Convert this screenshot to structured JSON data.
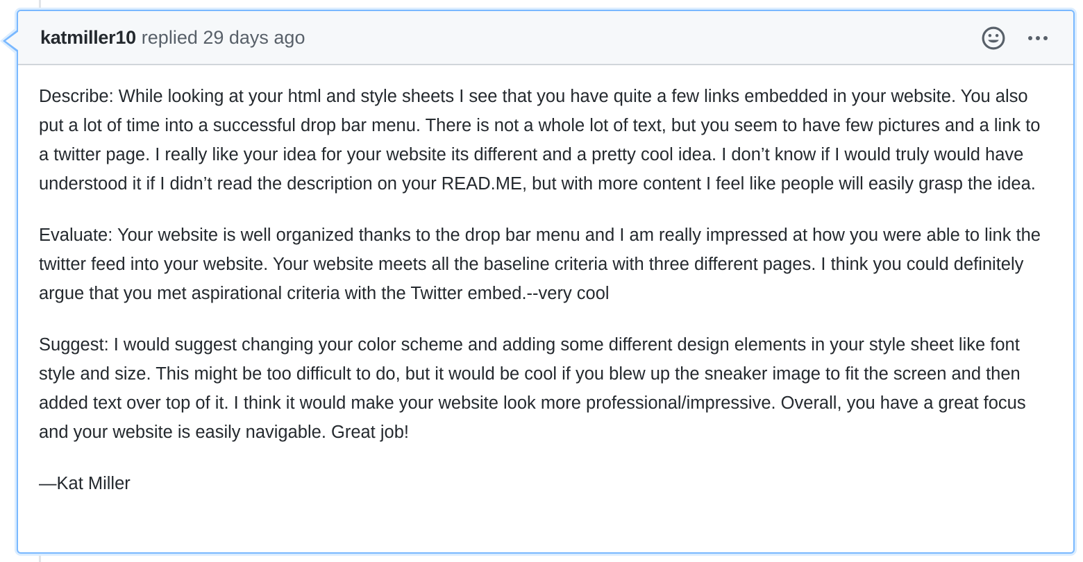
{
  "comment": {
    "author": "katmiller10",
    "meta": "replied 29 days ago",
    "paragraphs": [
      "Describe: While looking at your html and style sheets I see that you have quite a few links embedded in your website. You also put a lot of time into a successful drop bar menu. There is not a whole lot of text, but you seem to have few pictures and a link to a twitter page. I really like your idea for your website its different and a pretty cool idea. I don’t know if I would truly would have understood it if I didn’t read the description on your READ.ME, but with more content I feel like people will easily grasp the idea.",
      "Evaluate: Your website is well organized thanks to the drop bar menu and I am really impressed at how you were able to link the twitter feed into your website. Your website meets all the baseline criteria with three different pages. I think you could definitely argue that you met aspirational criteria with the Twitter embed.--very cool",
      "Suggest: I would suggest changing your color scheme and adding some different design elements in your style sheet like font style and size. This might be too difficult to do, but it would be cool if you blew up the sneaker image to fit the screen and then added text over top of it. I think it would make your website look more professional/impressive. Overall, you have a great focus and your website is easily navigable. Great job!"
    ],
    "signature": "—Kat Miller"
  },
  "icons": {
    "reaction": "smiley-icon",
    "more": "kebab-horizontal-icon"
  },
  "colors": {
    "focus_border": "#79b8ff",
    "header_bg": "#f6f8fa",
    "meta_text": "#586069",
    "icon": "#586069"
  }
}
